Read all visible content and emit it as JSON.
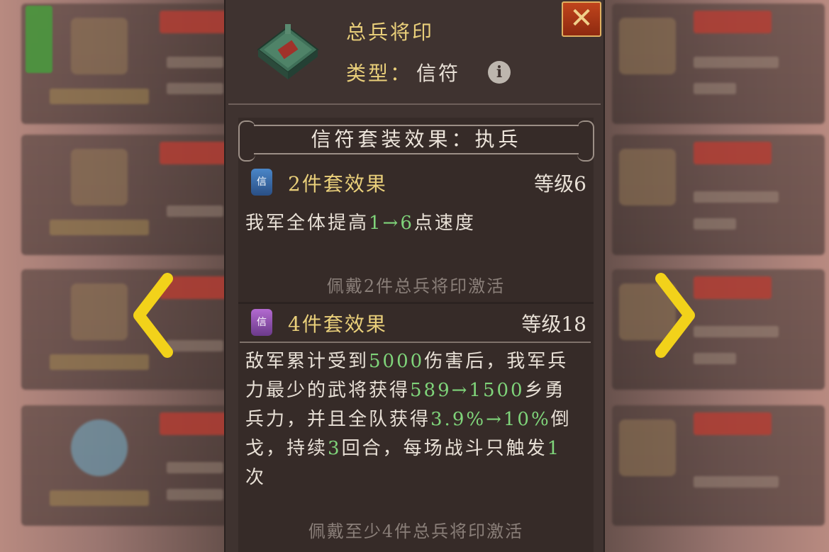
{
  "item": {
    "name": "总兵将印",
    "type_label": "类型：",
    "type_value": "信符",
    "info_icon": "i"
  },
  "close_icon": "✕",
  "set": {
    "title": "信符套装效果：执兵",
    "effects": [
      {
        "icon_glyph": "信",
        "title": "2件套效果",
        "level": "等级6",
        "desc_parts": [
          "我军全体提高",
          "1→6",
          "点速度"
        ],
        "activate": "佩戴2件总兵将印激活"
      },
      {
        "icon_glyph": "信",
        "title": "4件套效果",
        "level": "等级18",
        "desc_parts": [
          "敌军累计受到",
          "5000",
          "伤害后，我军兵力最少的武将获得",
          "589→1500",
          "乡勇兵力，并且全队获得",
          "3.9%→10%",
          "倒戈，持续",
          "3",
          "回合，每场战斗只触发",
          "1",
          "次"
        ],
        "activate": "佩戴至少4件总兵将印激活"
      }
    ]
  },
  "colors": {
    "gold_text": "#e9cf7a",
    "highlight_green": "#7fd47a",
    "arrow_yellow": "#f2d21a"
  }
}
